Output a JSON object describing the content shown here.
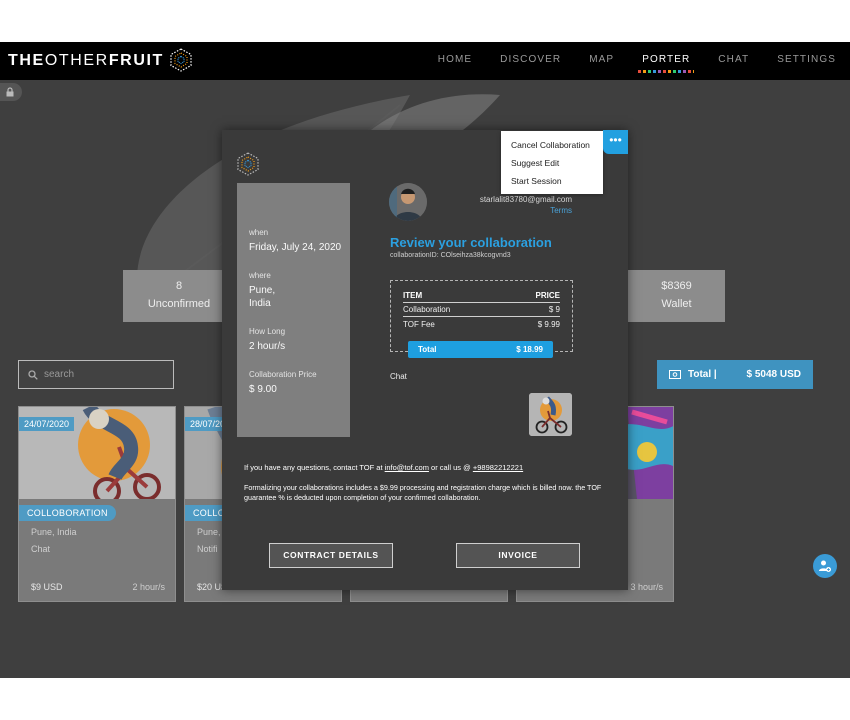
{
  "brand": {
    "name_part1": "THE",
    "name_part2": "OTHER",
    "name_part3": "FRUIT"
  },
  "nav": {
    "items": [
      "HOME",
      "DISCOVER",
      "MAP",
      "PORTER",
      "CHAT",
      "SETTINGS"
    ],
    "active": "PORTER"
  },
  "stats": [
    {
      "value": "8",
      "label": "Unconfirmed"
    },
    {
      "value": "$8369",
      "label": "Wallet"
    }
  ],
  "search": {
    "placeholder": "search"
  },
  "total_button": {
    "label": "Total |",
    "amount": "$ 5048 USD"
  },
  "cards": [
    {
      "date": "24/07/2020",
      "tag": "COLLOBORATION",
      "location": "Pune, India",
      "type": "Chat",
      "price": "$9 USD",
      "duration": "2 hour/s"
    },
    {
      "date": "28/07/2020",
      "tag": "COLLOBORATION",
      "location": "Pune, I",
      "type": "Notifi",
      "price": "$20 US",
      "duration": ""
    },
    {
      "duration": "3 hour/s"
    }
  ],
  "modal": {
    "details": {
      "when_label": "when",
      "when_value": "Friday, July 24, 2020",
      "where_label": "where",
      "where_line1": "Pune,",
      "where_line2": "India",
      "how_long_label": "How Long",
      "how_long_value": "2 hour/s",
      "price_label": "Collaboration Price",
      "price_value": "$ 9.00"
    },
    "email": "starlalit83780@gmail.com",
    "terms": "Terms",
    "title": "Review your collaboration",
    "collab_id": "collaborationID: COlseihza38kcogvnd3",
    "price_table": {
      "col_item": "ITEM",
      "col_price": "PRICE",
      "rows": [
        {
          "item": "Collaboration",
          "price": "$ 9"
        },
        {
          "item": "TOF Fee",
          "price": "$ 9.99"
        }
      ],
      "total_label": "Total",
      "total_value": "$ 18.99"
    },
    "chat_label": "Chat",
    "contact_pre": "If you have any questions, contact TOF at",
    "contact_email": "info@tof.com",
    "contact_mid": "or call us @",
    "contact_phone": "+98982212221",
    "formalizing": "Formalizing your collaborations includes a $9.99 processing and registration charge which is billed now. the TOF guarantee % is deducted upon completion of your confirmed collaboration.",
    "btn_contract": "CONTRACT DETAILS",
    "btn_invoice": "INVOICE"
  },
  "menu": {
    "items": [
      "Cancel Collaboration",
      "Suggest Edit",
      "Start Session"
    ],
    "trigger": "•••"
  }
}
